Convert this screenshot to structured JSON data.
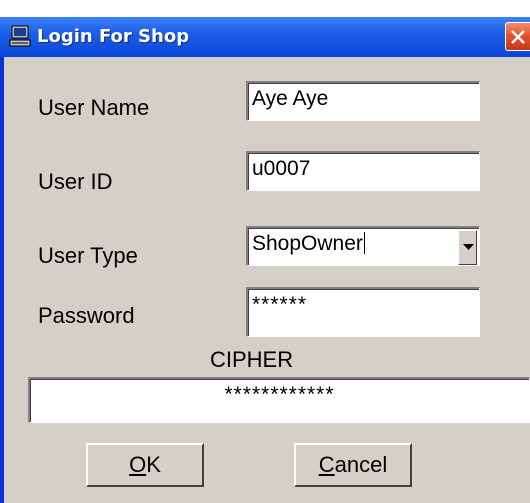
{
  "window": {
    "title": "Login For Shop",
    "title_icon": "computer-icon",
    "close_icon": "close-icon",
    "colors": {
      "titlebar": "#0a46d6",
      "client": "#d4d0c8",
      "close": "#e0502c"
    }
  },
  "form": {
    "user_name_label": "User Name",
    "user_name_value": "Aye Aye",
    "user_id_label": "User ID",
    "user_id_value": "u0007",
    "user_type_label": "User Type",
    "user_type_value": "ShopOwner",
    "password_label": "Password",
    "password_value": "******",
    "cipher_label": "CIPHER",
    "cipher_value": "************"
  },
  "buttons": {
    "ok_mnemonic": "O",
    "ok_rest": "K",
    "cancel_mnemonic": "C",
    "cancel_rest": "ancel"
  }
}
